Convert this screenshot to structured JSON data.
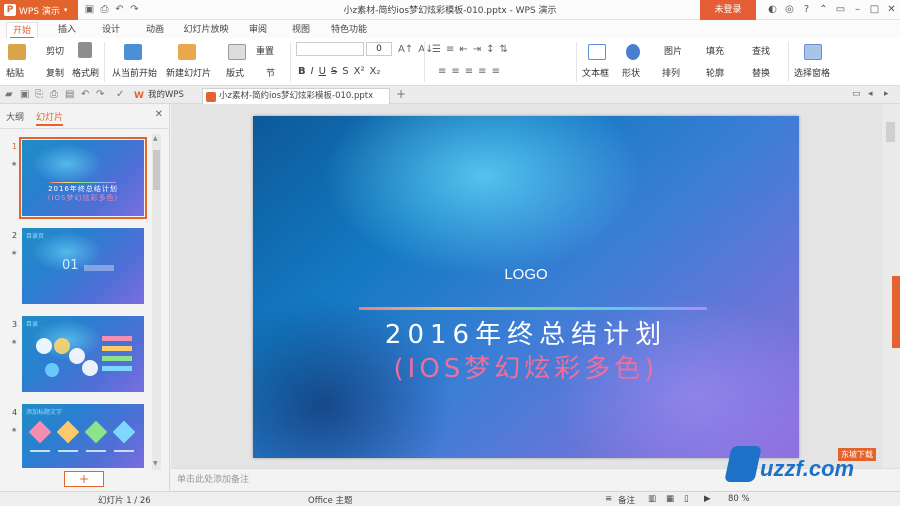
{
  "app": {
    "name": "WPS 演示",
    "window_title": "小z素材-简约ios梦幻炫彩模板-010.pptx - WPS 演示",
    "login": "未登录"
  },
  "menu": {
    "tabs": [
      "开始",
      "插入",
      "设计",
      "动画",
      "幻灯片放映",
      "审阅",
      "视图",
      "特色功能"
    ]
  },
  "ribbon": {
    "paste": "粘贴",
    "cut": "剪切",
    "copy": "复制",
    "format_painter": "格式刷",
    "play_from_current": "从当前开始",
    "new_slide": "新建幻灯片",
    "layout": "版式",
    "section": "节",
    "reset": "重置",
    "font_name": "",
    "font_size": "0",
    "text_box": "文本框",
    "shape": "形状",
    "arrange": "排列",
    "picture": "图片",
    "fill": "填充",
    "outline": "轮廓",
    "find": "查找",
    "replace": "替换",
    "select_pane": "选择窗格"
  },
  "doc_tabs": {
    "home": "我的WPS",
    "file": "小z素材-简约ios梦幻炫彩模板-010.pptx"
  },
  "left_panel": {
    "tabs": [
      "大纲",
      "幻灯片"
    ],
    "slides": [
      {
        "num": "1",
        "title": "2016年终总结计划",
        "sub": "(IOS梦幻炫彩多色)"
      },
      {
        "num": "2",
        "head": "目录页",
        "big": "01"
      },
      {
        "num": "3",
        "head": "目录"
      },
      {
        "num": "4",
        "head": "添加标题文字"
      }
    ]
  },
  "slide": {
    "logo": "LOGO",
    "title": "2016年终总结计划",
    "subtitle": "(IOS梦幻炫彩多色)"
  },
  "notes_placeholder": "单击此处添加备注",
  "status": {
    "slide_counter": "幻灯片 1 / 26",
    "theme": "Office 主题",
    "notes": "备注",
    "zoom": "80 %"
  },
  "watermark": {
    "text": "uzzf.com",
    "tag": "东坡下载"
  },
  "colors": {
    "accent": "#e2642c"
  }
}
